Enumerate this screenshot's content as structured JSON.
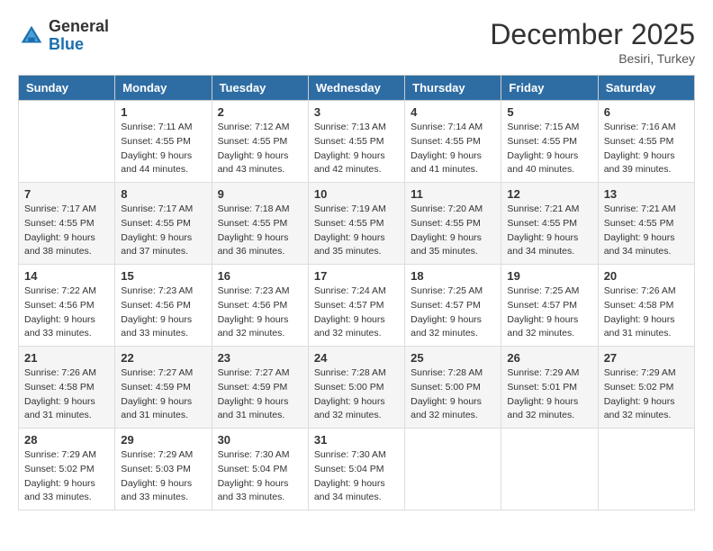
{
  "header": {
    "logo_general": "General",
    "logo_blue": "Blue",
    "month": "December 2025",
    "location": "Besiri, Turkey"
  },
  "days_of_week": [
    "Sunday",
    "Monday",
    "Tuesday",
    "Wednesday",
    "Thursday",
    "Friday",
    "Saturday"
  ],
  "weeks": [
    [
      {
        "day": "",
        "sunrise": "",
        "sunset": "",
        "daylight": ""
      },
      {
        "day": "1",
        "sunrise": "Sunrise: 7:11 AM",
        "sunset": "Sunset: 4:55 PM",
        "daylight": "Daylight: 9 hours and 44 minutes."
      },
      {
        "day": "2",
        "sunrise": "Sunrise: 7:12 AM",
        "sunset": "Sunset: 4:55 PM",
        "daylight": "Daylight: 9 hours and 43 minutes."
      },
      {
        "day": "3",
        "sunrise": "Sunrise: 7:13 AM",
        "sunset": "Sunset: 4:55 PM",
        "daylight": "Daylight: 9 hours and 42 minutes."
      },
      {
        "day": "4",
        "sunrise": "Sunrise: 7:14 AM",
        "sunset": "Sunset: 4:55 PM",
        "daylight": "Daylight: 9 hours and 41 minutes."
      },
      {
        "day": "5",
        "sunrise": "Sunrise: 7:15 AM",
        "sunset": "Sunset: 4:55 PM",
        "daylight": "Daylight: 9 hours and 40 minutes."
      },
      {
        "day": "6",
        "sunrise": "Sunrise: 7:16 AM",
        "sunset": "Sunset: 4:55 PM",
        "daylight": "Daylight: 9 hours and 39 minutes."
      }
    ],
    [
      {
        "day": "7",
        "sunrise": "Sunrise: 7:17 AM",
        "sunset": "Sunset: 4:55 PM",
        "daylight": "Daylight: 9 hours and 38 minutes."
      },
      {
        "day": "8",
        "sunrise": "Sunrise: 7:17 AM",
        "sunset": "Sunset: 4:55 PM",
        "daylight": "Daylight: 9 hours and 37 minutes."
      },
      {
        "day": "9",
        "sunrise": "Sunrise: 7:18 AM",
        "sunset": "Sunset: 4:55 PM",
        "daylight": "Daylight: 9 hours and 36 minutes."
      },
      {
        "day": "10",
        "sunrise": "Sunrise: 7:19 AM",
        "sunset": "Sunset: 4:55 PM",
        "daylight": "Daylight: 9 hours and 35 minutes."
      },
      {
        "day": "11",
        "sunrise": "Sunrise: 7:20 AM",
        "sunset": "Sunset: 4:55 PM",
        "daylight": "Daylight: 9 hours and 35 minutes."
      },
      {
        "day": "12",
        "sunrise": "Sunrise: 7:21 AM",
        "sunset": "Sunset: 4:55 PM",
        "daylight": "Daylight: 9 hours and 34 minutes."
      },
      {
        "day": "13",
        "sunrise": "Sunrise: 7:21 AM",
        "sunset": "Sunset: 4:55 PM",
        "daylight": "Daylight: 9 hours and 34 minutes."
      }
    ],
    [
      {
        "day": "14",
        "sunrise": "Sunrise: 7:22 AM",
        "sunset": "Sunset: 4:56 PM",
        "daylight": "Daylight: 9 hours and 33 minutes."
      },
      {
        "day": "15",
        "sunrise": "Sunrise: 7:23 AM",
        "sunset": "Sunset: 4:56 PM",
        "daylight": "Daylight: 9 hours and 33 minutes."
      },
      {
        "day": "16",
        "sunrise": "Sunrise: 7:23 AM",
        "sunset": "Sunset: 4:56 PM",
        "daylight": "Daylight: 9 hours and 32 minutes."
      },
      {
        "day": "17",
        "sunrise": "Sunrise: 7:24 AM",
        "sunset": "Sunset: 4:57 PM",
        "daylight": "Daylight: 9 hours and 32 minutes."
      },
      {
        "day": "18",
        "sunrise": "Sunrise: 7:25 AM",
        "sunset": "Sunset: 4:57 PM",
        "daylight": "Daylight: 9 hours and 32 minutes."
      },
      {
        "day": "19",
        "sunrise": "Sunrise: 7:25 AM",
        "sunset": "Sunset: 4:57 PM",
        "daylight": "Daylight: 9 hours and 32 minutes."
      },
      {
        "day": "20",
        "sunrise": "Sunrise: 7:26 AM",
        "sunset": "Sunset: 4:58 PM",
        "daylight": "Daylight: 9 hours and 31 minutes."
      }
    ],
    [
      {
        "day": "21",
        "sunrise": "Sunrise: 7:26 AM",
        "sunset": "Sunset: 4:58 PM",
        "daylight": "Daylight: 9 hours and 31 minutes."
      },
      {
        "day": "22",
        "sunrise": "Sunrise: 7:27 AM",
        "sunset": "Sunset: 4:59 PM",
        "daylight": "Daylight: 9 hours and 31 minutes."
      },
      {
        "day": "23",
        "sunrise": "Sunrise: 7:27 AM",
        "sunset": "Sunset: 4:59 PM",
        "daylight": "Daylight: 9 hours and 31 minutes."
      },
      {
        "day": "24",
        "sunrise": "Sunrise: 7:28 AM",
        "sunset": "Sunset: 5:00 PM",
        "daylight": "Daylight: 9 hours and 32 minutes."
      },
      {
        "day": "25",
        "sunrise": "Sunrise: 7:28 AM",
        "sunset": "Sunset: 5:00 PM",
        "daylight": "Daylight: 9 hours and 32 minutes."
      },
      {
        "day": "26",
        "sunrise": "Sunrise: 7:29 AM",
        "sunset": "Sunset: 5:01 PM",
        "daylight": "Daylight: 9 hours and 32 minutes."
      },
      {
        "day": "27",
        "sunrise": "Sunrise: 7:29 AM",
        "sunset": "Sunset: 5:02 PM",
        "daylight": "Daylight: 9 hours and 32 minutes."
      }
    ],
    [
      {
        "day": "28",
        "sunrise": "Sunrise: 7:29 AM",
        "sunset": "Sunset: 5:02 PM",
        "daylight": "Daylight: 9 hours and 33 minutes."
      },
      {
        "day": "29",
        "sunrise": "Sunrise: 7:29 AM",
        "sunset": "Sunset: 5:03 PM",
        "daylight": "Daylight: 9 hours and 33 minutes."
      },
      {
        "day": "30",
        "sunrise": "Sunrise: 7:30 AM",
        "sunset": "Sunset: 5:04 PM",
        "daylight": "Daylight: 9 hours and 33 minutes."
      },
      {
        "day": "31",
        "sunrise": "Sunrise: 7:30 AM",
        "sunset": "Sunset: 5:04 PM",
        "daylight": "Daylight: 9 hours and 34 minutes."
      },
      {
        "day": "",
        "sunrise": "",
        "sunset": "",
        "daylight": ""
      },
      {
        "day": "",
        "sunrise": "",
        "sunset": "",
        "daylight": ""
      },
      {
        "day": "",
        "sunrise": "",
        "sunset": "",
        "daylight": ""
      }
    ]
  ]
}
